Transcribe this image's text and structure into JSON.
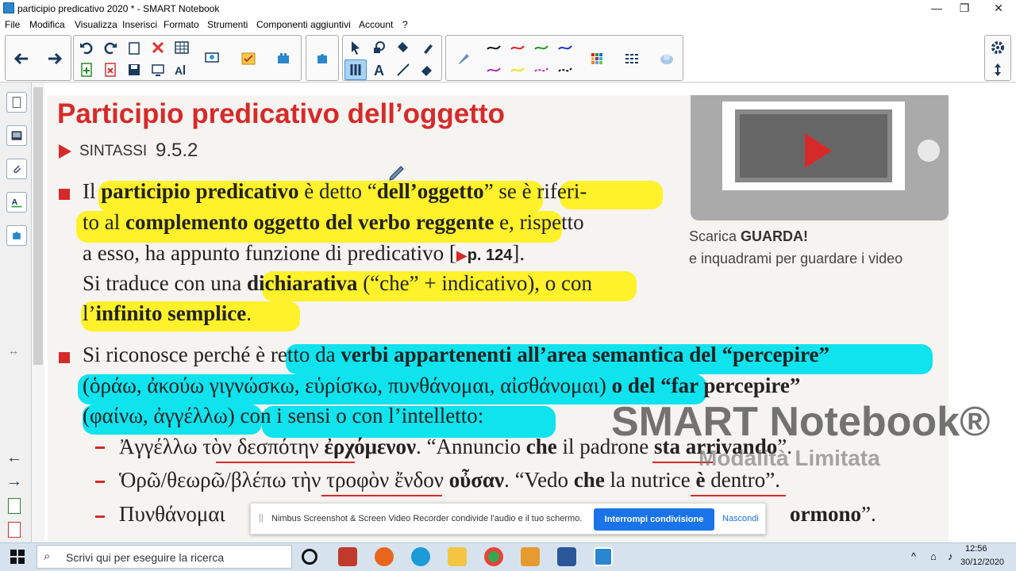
{
  "window": {
    "title": "participio predicativo 2020 * - SMART Notebook",
    "minimize_label": "—",
    "maximize_label": "❐",
    "close_label": "✕"
  },
  "menu": [
    "File",
    "Modifica",
    "Visualizza",
    "Inserisci",
    "Formato",
    "Strumenti",
    "Componenti aggiuntivi",
    "Account",
    "?"
  ],
  "page": {
    "title": "Participio predicativo dell’oggetto",
    "section_label": "SINTASSI",
    "section_number": "9.5.2",
    "para1": {
      "line1_a": "Il ",
      "line1_b": "participio predicativo",
      "line1_c": " è detto “",
      "line1_d": "dell’oggetto",
      "line1_e": "” se è riferi-",
      "line2_a": "to al ",
      "line2_b": "complemento oggetto del verbo reggente",
      "line2_c": " e, rispetto",
      "line3_a": "a esso, ha appunto funzione di predicativo [",
      "line3_ref": "p. 124",
      "line3_b": "].",
      "line4_a": "Si traduce con una ",
      "line4_b": "dichiarativa",
      "line4_c": " (“che” + indicativo), o con",
      "line5_a": "l’",
      "line5_b": "infinito semplice",
      "line5_c": "."
    },
    "para2": {
      "line1_a": "Si riconosce perché è retto da ",
      "line1_b": "verbi appartenenti all’area semantica del “percepire”",
      "line2_a": "(ὁράω, ἀκούω γιγνώσκω, εὑρίσκω, πυνθάνομαι, αἰσθάνομαι) ",
      "line2_b": "o del “far percepire”",
      "line3_a": "(φαίνω, ἀγγέλλω) con i sensi o con l’intelletto:"
    },
    "examples": [
      {
        "greek": "Ἀγγέλλω τὸν δεσπότην ",
        "greek_bold": "ἐρχόμενον",
        "latin": ". “Annuncio ",
        "che": "che",
        "rest": " il padrone ",
        "verb": "sta arrivando",
        "end": "”."
      },
      {
        "greek": "Ὁρῶ/θεωρῶ/βλέπω τὴν τροφὸν ἔνδον ",
        "greek_bold": "οὖσαν",
        "latin": ". “Vedo ",
        "che": "che",
        "rest": " la nutrice ",
        "verb": "è",
        "end": " dentro”."
      },
      {
        "greek": "Πυνθάνομαι",
        "greek_bold": "",
        "latin": "",
        "che": "",
        "rest": "",
        "verb": "ormono",
        "end": "”."
      }
    ],
    "guarda_a": "Scarica ",
    "guarda_b": "GUARDA!",
    "guarda_line2": "e inquadrami per guardare i video"
  },
  "watermark": {
    "line1": "SMART Notebook®",
    "line2": "Modalità Limitata"
  },
  "share_bar": {
    "message": "Nimbus Screenshot & Screen Video Recorder condivide l'audio e il tuo schermo.",
    "stop_label": "Interrompi condivisione",
    "hide_label": "Nascondi"
  },
  "taskbar": {
    "search_placeholder": "Scrivi qui per eseguire la ricerca",
    "time": "12:56",
    "date": "30/12/2020"
  },
  "colors": {
    "accent_red": "#d62a2a",
    "highlight_yellow": "#fff12a",
    "highlight_cyan": "#0fe3ee",
    "share_button": "#1a73e8"
  }
}
